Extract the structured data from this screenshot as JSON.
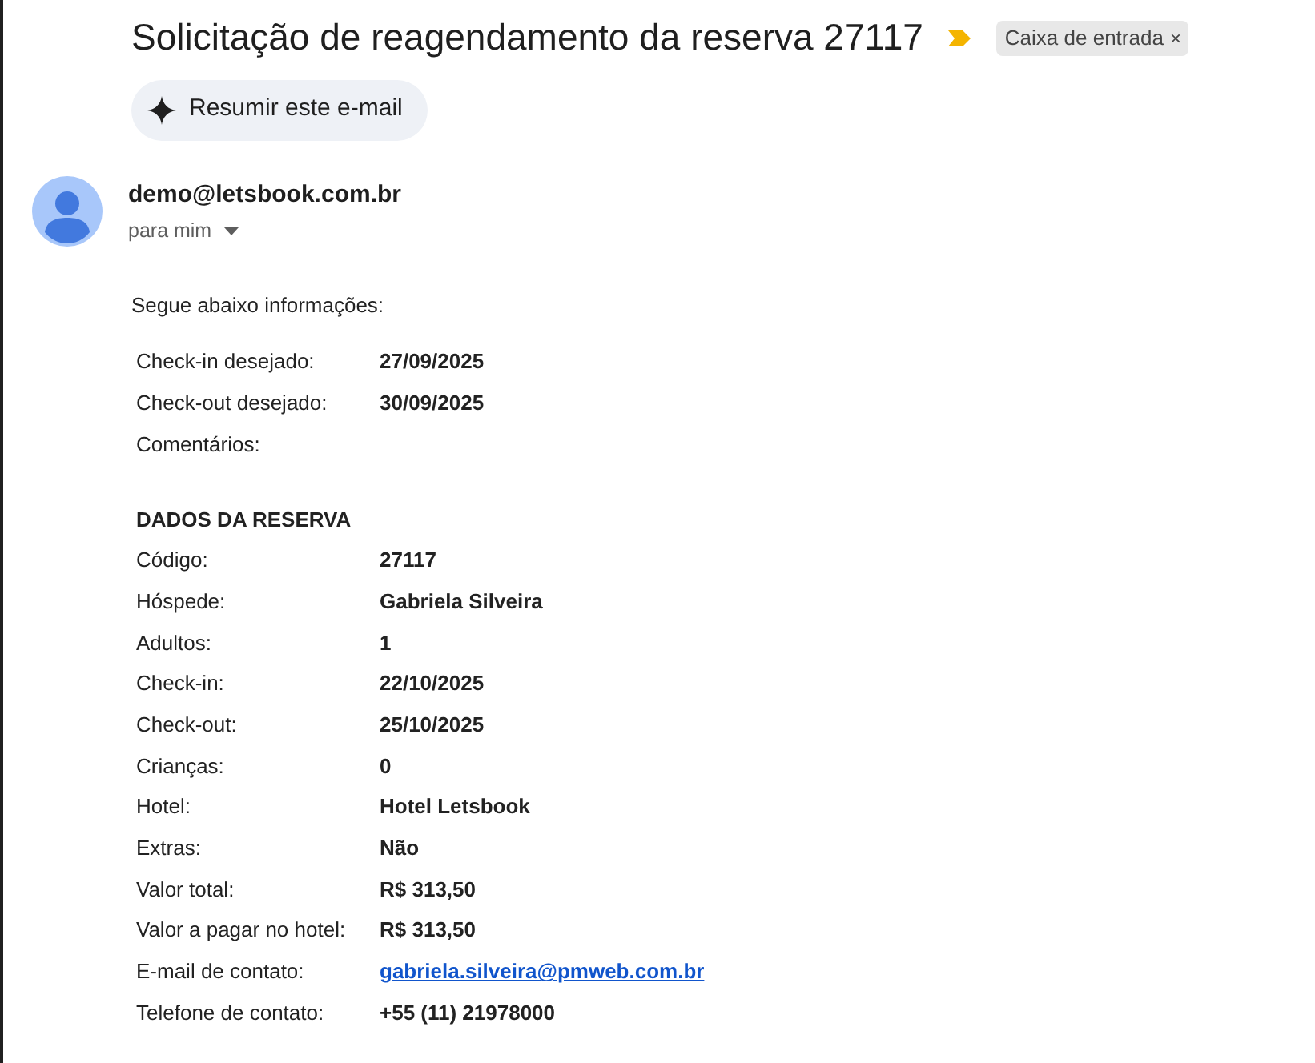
{
  "subject": "Solicitação de reagendamento da reserva 27117",
  "label_chip": {
    "text": "Caixa de entrada",
    "close": "×"
  },
  "summarize_button": "Resumir este e-mail",
  "sender": {
    "address": "demo@letsbook.com.br",
    "recipient": "para mim"
  },
  "intro": "Segue abaixo informações:",
  "request_rows": [
    {
      "label": "Check-in desejado:",
      "value": "27/09/2025",
      "kind": "text"
    },
    {
      "label": "Check-out desejado:",
      "value": "30/09/2025",
      "kind": "text"
    },
    {
      "label": "Comentários:",
      "kind": "empty"
    }
  ],
  "section_heading": "DADOS DA RESERVA",
  "booking_rows": [
    {
      "label": "Código:",
      "value": "27117",
      "kind": "text"
    },
    {
      "label": "Hóspede:",
      "value": "Gabriela Silveira",
      "kind": "text"
    },
    {
      "label": "Adultos:",
      "value": "1",
      "kind": "text"
    },
    {
      "label": "Check-in:",
      "value": "22/10/2025",
      "kind": "text"
    },
    {
      "label": "Check-out:",
      "value": "25/10/2025",
      "kind": "text"
    },
    {
      "label": "Crianças:",
      "value": "0",
      "kind": "text"
    },
    {
      "label": "Hotel:",
      "value": "Hotel Letsbook",
      "kind": "text"
    },
    {
      "label": "Extras:",
      "value": "Não",
      "kind": "text"
    },
    {
      "label": "Valor total:",
      "value": "R$ 313,50",
      "kind": "text"
    },
    {
      "label": "Valor a pagar no hotel:",
      "value": "R$ 313,50",
      "kind": "text"
    },
    {
      "label": "E-mail de contato:",
      "value": "gabriela.silveira@pmweb.com.br",
      "kind": "link"
    },
    {
      "label": "Telefone de contato:",
      "value": "+55 (11) 21978000",
      "kind": "text"
    }
  ]
}
